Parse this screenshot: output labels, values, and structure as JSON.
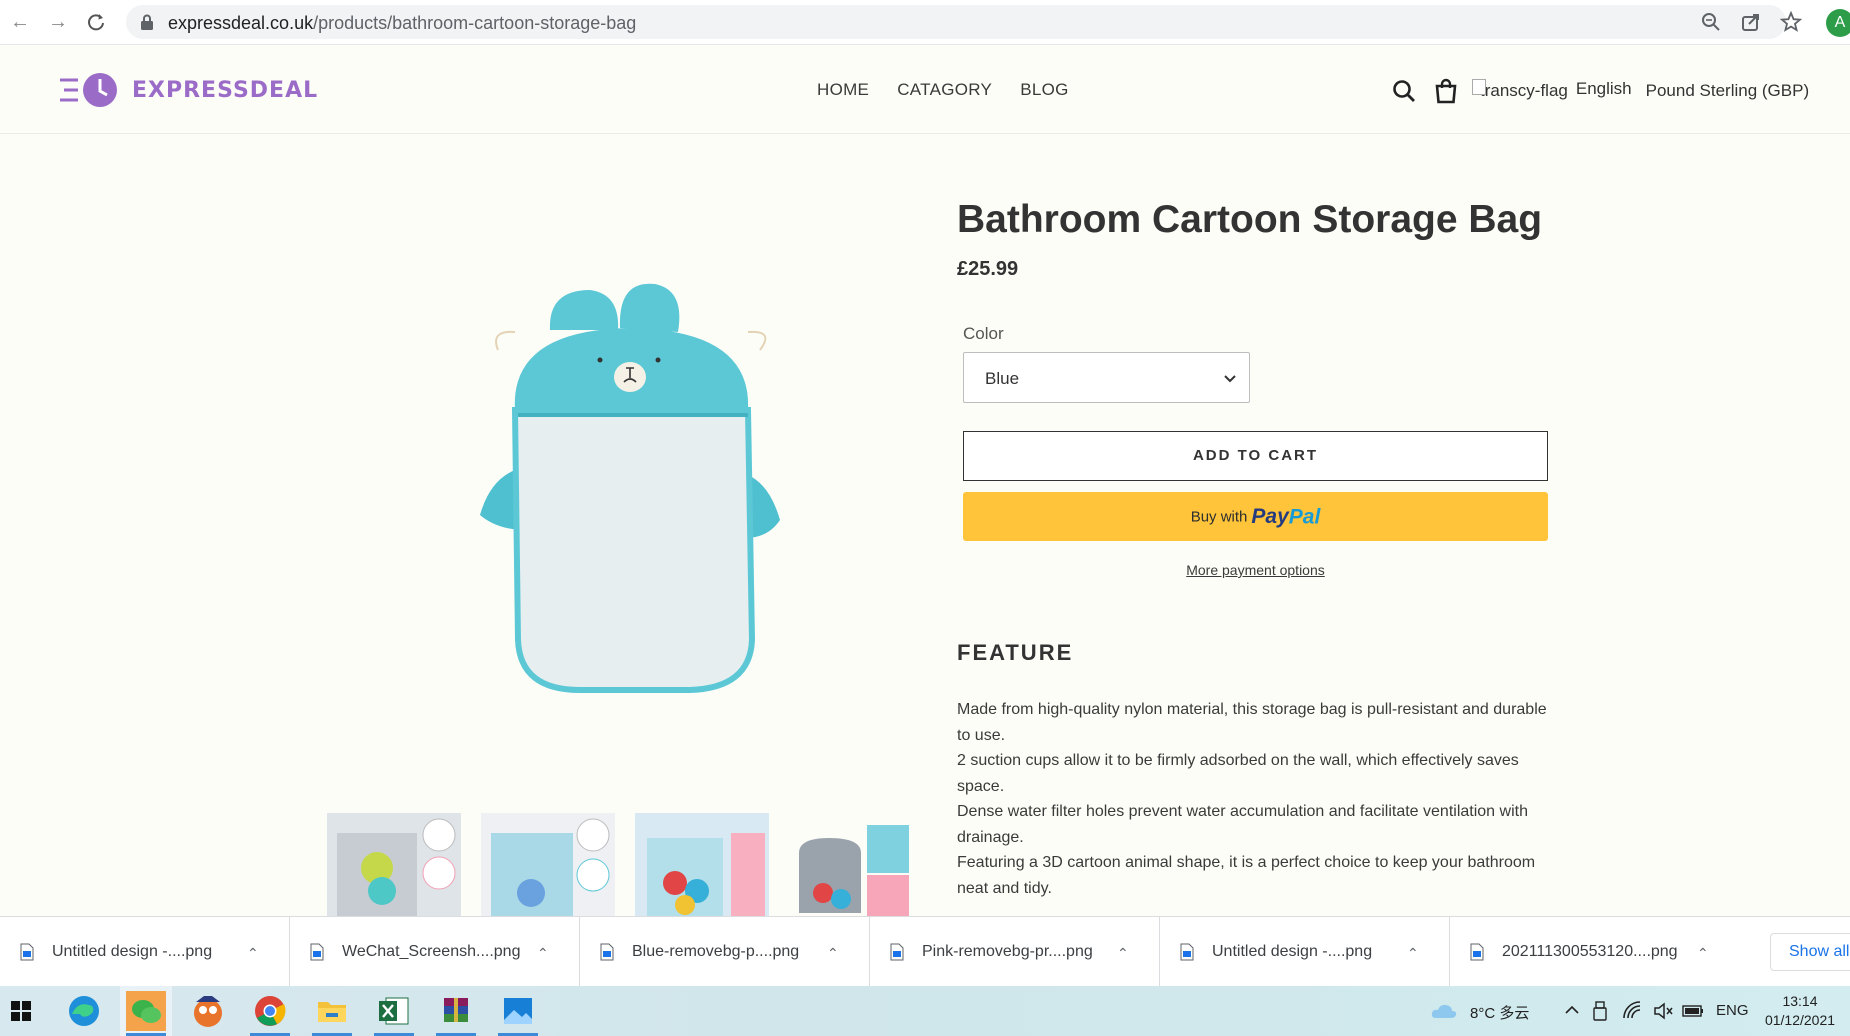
{
  "browser": {
    "url_domain": "expressdeal.co.uk",
    "url_path": "/products/bathroom-cartoon-storage-bag",
    "profile_initial": "A"
  },
  "header": {
    "logo_text": "EXPRESSDEAL",
    "nav": [
      "HOME",
      "CATAGORY",
      "BLOG"
    ],
    "flag_alt": "transcy-flag",
    "language": "English",
    "currency": "Pound Sterling (GBP)"
  },
  "product": {
    "title": "Bathroom Cartoon Storage Bag",
    "price": "£25.99",
    "color_label": "Color",
    "color_selected": "Blue",
    "add_to_cart": "ADD TO CART",
    "paypal_buy": "Buy with",
    "paypal_pay": "Pay",
    "paypal_pal": "Pal",
    "more_payment": "More payment options",
    "feature_heading": "FEATURE",
    "feature_lines": [
      "Made from high-quality nylon material, this storage bag is pull-resistant and durable to use.",
      "2 suction cups allow it to be firmly adsorbed on the wall, which effectively saves space.",
      "Dense water filter holes prevent water accumulation and facilitate ventilation with drainage.",
      "Featuring a 3D cartoon animal shape, it is a perfect choice to keep your bathroom neat and tidy."
    ]
  },
  "downloads": {
    "items": [
      "Untitled design -....png",
      "WeChat_Screensh....png",
      "Blue-removebg-p....png",
      "Pink-removebg-pr....png",
      "Untitled design -....png",
      "202111300553120....png"
    ],
    "show_all": "Show all"
  },
  "taskbar": {
    "weather": "8°C 多云",
    "lang": "ENG",
    "time": "13:14",
    "date": "01/12/2021"
  },
  "colors": {
    "accent_purple": "#9a6cc8",
    "paypal_yellow": "#ffc439",
    "bag_teal": "#5cc8d6"
  }
}
